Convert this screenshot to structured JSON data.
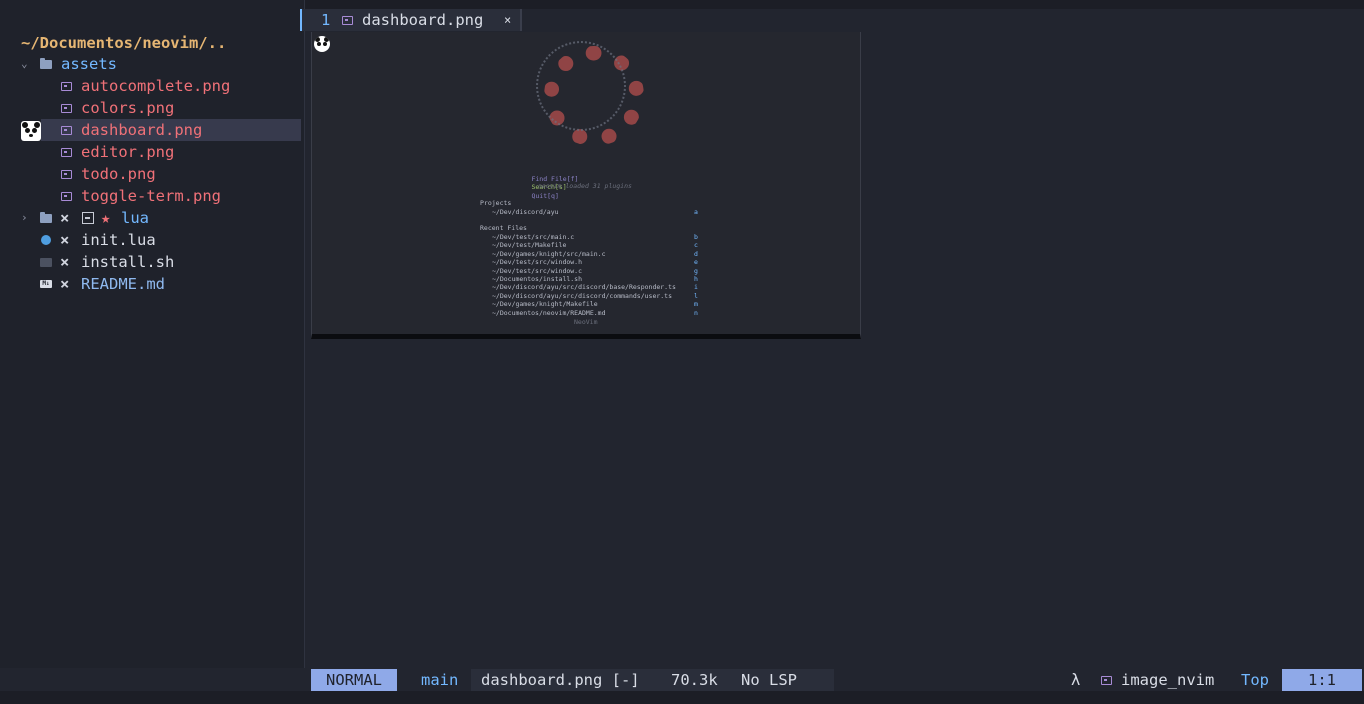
{
  "sidebar": {
    "root_path": "~/Documentos/neovim/..",
    "items": [
      {
        "chevron": "⌄",
        "name": "assets",
        "kind": "dir"
      },
      {
        "name": "autocomplete.png",
        "kind": "png"
      },
      {
        "name": "colors.png",
        "kind": "png"
      },
      {
        "name": "dashboard.png",
        "kind": "png",
        "selected": true
      },
      {
        "name": "editor.png",
        "kind": "png"
      },
      {
        "name": "todo.png",
        "kind": "png"
      },
      {
        "name": "toggle-term.png",
        "kind": "png"
      },
      {
        "chevron": "›",
        "mark": "×",
        "star": "★",
        "name": "lua",
        "kind": "dir"
      },
      {
        "mark": "×",
        "name": "init.lua",
        "kind": "lua"
      },
      {
        "mark": "×",
        "name": "install.sh",
        "kind": "sh"
      },
      {
        "mark": "×",
        "name": "README.md",
        "kind": "md"
      }
    ]
  },
  "tab": {
    "number": "1",
    "name": "dashboard.png",
    "close": "×"
  },
  "preview": {
    "menu": {
      "find": "Find File[f]",
      "search": "Search[s]",
      "quit": "Quit[q]"
    },
    "loaded": "neovim loaded 31 plugins",
    "projects_title": "Projects",
    "projects": [
      {
        "path": "~/Dev/discord/ayu",
        "key": "a"
      }
    ],
    "recent_title": "Recent Files",
    "recent": [
      {
        "path": "~/Dev/test/src/main.c",
        "key": "b"
      },
      {
        "path": "~/Dev/test/Makefile",
        "key": "c"
      },
      {
        "path": "~/Dev/games/knight/src/main.c",
        "key": "d"
      },
      {
        "path": "~/Dev/test/src/window.h",
        "key": "e"
      },
      {
        "path": "~/Dev/test/src/window.c",
        "key": "g"
      },
      {
        "path": "~/Documentos/install.sh",
        "key": "h"
      },
      {
        "path": "~/Dev/discord/ayu/src/discord/base/Responder.ts",
        "key": "i"
      },
      {
        "path": "~/Dev/discord/ayu/src/discord/commands/user.ts",
        "key": "l"
      },
      {
        "path": "~/Dev/games/knight/Makefile",
        "key": "m"
      },
      {
        "path": "~/Documentos/neovim/README.md",
        "key": "n"
      }
    ],
    "footer": "NeoVim"
  },
  "status": {
    "mode": "NORMAL",
    "branch_icon": "",
    "branch": "main",
    "file": "dashboard.png [-]",
    "size": "70.3k",
    "lsp": "No LSP",
    "lambda": "λ",
    "filetype": "image_nvim",
    "scroll": "Top",
    "position": "1:1"
  },
  "colors": {
    "background": "#22252f",
    "sidebar": "#1f222b",
    "accent": "#73b8ff",
    "png_file": "#f07178",
    "root_path": "#e6b673",
    "mode_bg": "#8fa9e8"
  }
}
